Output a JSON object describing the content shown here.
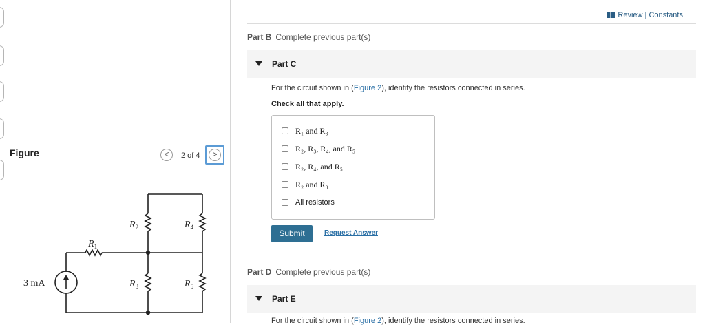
{
  "figure_panel": {
    "title": "Figure",
    "nav": {
      "prev": "<",
      "count": "2 of 4",
      "next": ">"
    },
    "circuit": {
      "source_label": "3 mA",
      "resistors": {
        "r1": "R1",
        "r2": "R2",
        "r3": "R3",
        "r4": "R4",
        "r5": "R5"
      }
    }
  },
  "header": {
    "review_link": "Review | Constants"
  },
  "part_b": {
    "name": "Part B",
    "status": "Complete previous part(s)"
  },
  "part_c": {
    "name": "Part C",
    "question_pre": "For the circuit shown in (",
    "question_link": "Figure 2",
    "question_post": "), identify the resistors connected in series.",
    "instruction": "Check all that apply.",
    "options": [
      "R₁ and R₃",
      "R₂, R₃, R₄, and R₅",
      "R₂, R₄, and R₅",
      "R₂ and R₃",
      "All resistors"
    ],
    "submit_label": "Submit",
    "request_label": "Request Answer"
  },
  "part_d": {
    "name": "Part D",
    "status": "Complete previous part(s)"
  },
  "part_e": {
    "name": "Part E",
    "question_pre": "For the circuit shown in (",
    "question_link": "Figure 2",
    "question_post": "), identify the resistors connected in series."
  }
}
